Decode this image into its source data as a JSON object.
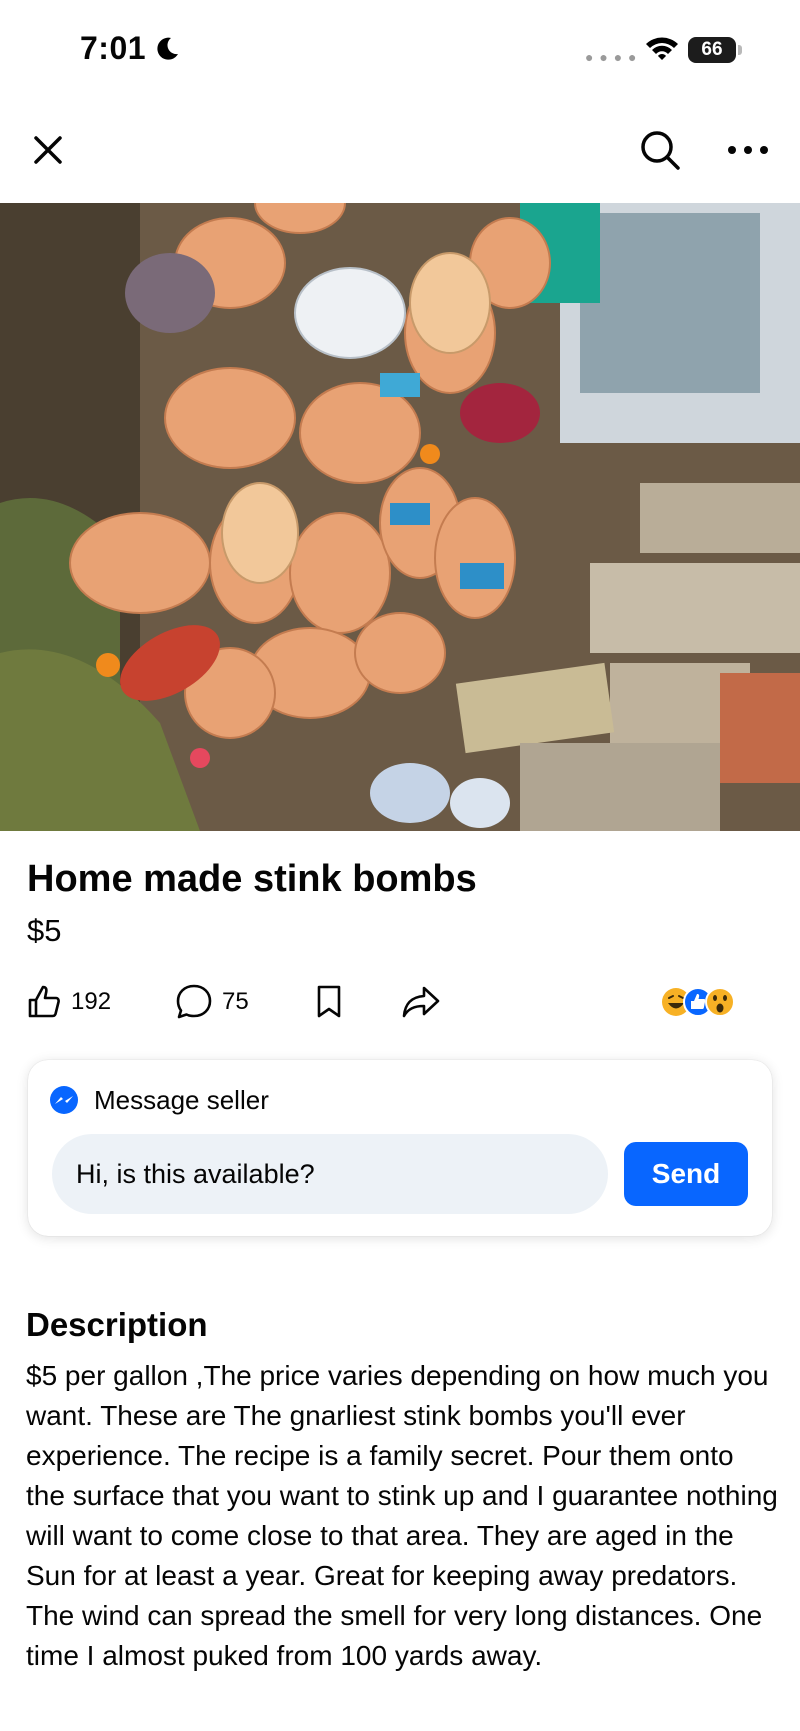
{
  "status_bar": {
    "time": "7:01",
    "battery": "66",
    "moon_icon": "moon-icon",
    "wifi_icon": "wifi-icon"
  },
  "nav": {
    "close_icon": "close-icon",
    "search_icon": "search-icon",
    "more_icon": "more-horizontal-icon"
  },
  "listing": {
    "title": "Home made stink bombs",
    "price": "$5"
  },
  "actions": {
    "likes": "192",
    "comments": "75",
    "like_icon": "thumbs-up-icon",
    "comment_icon": "comment-bubble-icon",
    "save_icon": "bookmark-icon",
    "share_icon": "share-arrow-icon",
    "reactions": [
      "haha",
      "like",
      "wow"
    ]
  },
  "message": {
    "header": "Message seller",
    "input_value": "Hi, is this available?",
    "send_label": "Send",
    "icon": "messenger-icon"
  },
  "description": {
    "heading": "Description",
    "body": "$5 per gallon ,The price varies depending on how much you want. These are The gnarliest stink bombs you'll ever experience. The recipe is a family secret. Pour them onto the surface that you want to stink up and I guarantee nothing will want to come close to that area. They are aged in the Sun for at least a year. Great for keeping away predators. The wind can spread the smell for very long distances. One time I almost puked from 100 yards away."
  },
  "colors": {
    "accent": "#0866ff",
    "input_bg": "#edf2f7",
    "text": "#050505"
  }
}
